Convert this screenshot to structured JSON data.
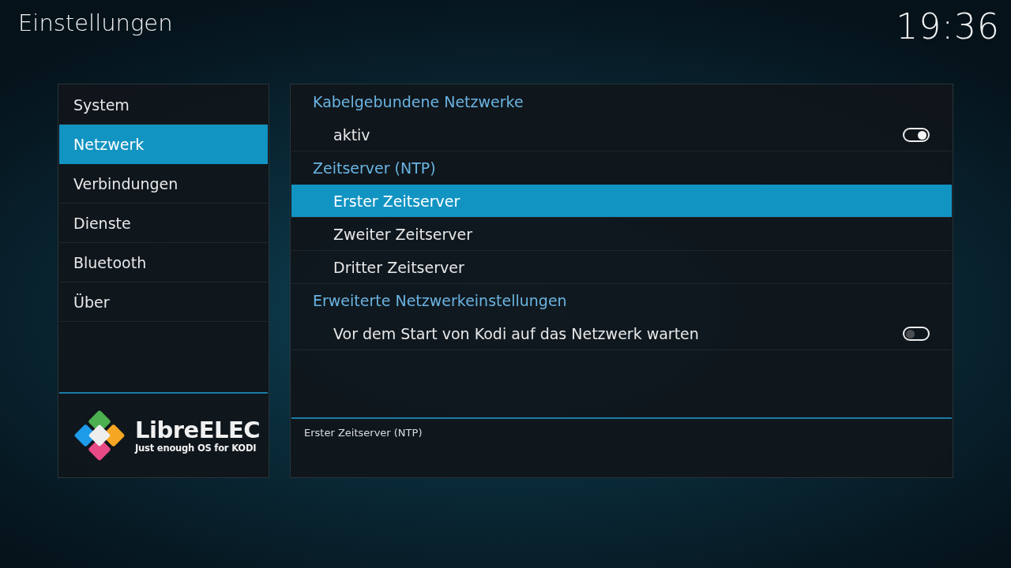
{
  "header": {
    "title": "Einstellungen",
    "clock": "19:36"
  },
  "categories": [
    {
      "label": "System",
      "selected": false
    },
    {
      "label": "Netzwerk",
      "selected": true
    },
    {
      "label": "Verbindungen",
      "selected": false
    },
    {
      "label": "Dienste",
      "selected": false
    },
    {
      "label": "Bluetooth",
      "selected": false
    },
    {
      "label": "Über",
      "selected": false
    }
  ],
  "logo": {
    "name": "LibreELEC",
    "tagline": "Just enough OS for KODI"
  },
  "settings": [
    {
      "kind": "heading",
      "label": "Kabelgebundene Netzwerke"
    },
    {
      "kind": "toggle",
      "label": "aktiv",
      "on": true,
      "selected": false
    },
    {
      "kind": "heading",
      "label": "Zeitserver (NTP)"
    },
    {
      "kind": "item",
      "label": "Erster Zeitserver",
      "selected": true
    },
    {
      "kind": "item",
      "label": "Zweiter Zeitserver",
      "selected": false
    },
    {
      "kind": "item",
      "label": "Dritter Zeitserver",
      "selected": false
    },
    {
      "kind": "heading",
      "label": "Erweiterte Netzwerkeinstellungen"
    },
    {
      "kind": "toggle",
      "label": "Vor dem Start von Kodi auf das Netzwerk warten",
      "on": false,
      "selected": false
    }
  ],
  "description": "Erster Zeitserver (NTP)"
}
